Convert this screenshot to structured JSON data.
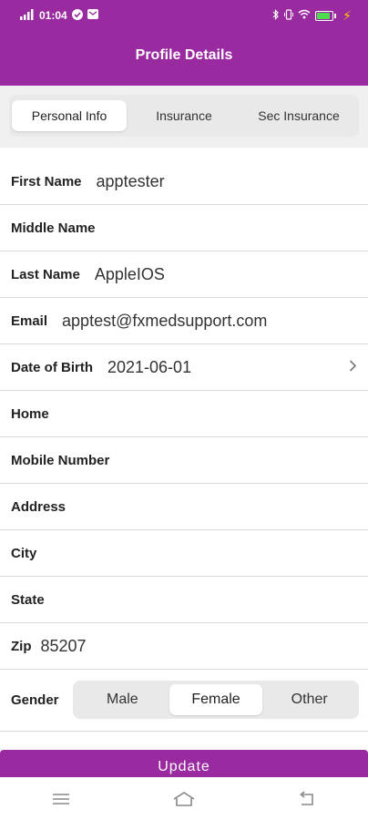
{
  "status_bar": {
    "time": "01:04",
    "signal_icon": "signal-icon",
    "check_icon": "check-circle-icon",
    "mail_icon": "mail-icon",
    "bluetooth_icon": "bluetooth-icon",
    "wifi_icon": "wifi-icon",
    "battery_level": "90",
    "battery_icon": "battery-icon",
    "charging_icon": "charging-bolt-icon"
  },
  "header": {
    "title": "Profile Details",
    "color": "#9a2aa0"
  },
  "tabs": [
    {
      "label": "Personal Info",
      "active": true
    },
    {
      "label": "Insurance",
      "active": false
    },
    {
      "label": "Sec Insurance",
      "active": false
    }
  ],
  "fields": {
    "first_name": {
      "label": "First Name",
      "value": "apptester"
    },
    "middle_name": {
      "label": "Middle Name",
      "value": ""
    },
    "last_name": {
      "label": "Last Name",
      "value": "AppleIOS"
    },
    "email": {
      "label": "Email",
      "value": "apptest@fxmedsupport.com"
    },
    "dob": {
      "label": "Date of Birth",
      "value": "2021-06-01"
    },
    "home": {
      "label": "Home",
      "value": ""
    },
    "mobile": {
      "label": "Mobile Number",
      "value": ""
    },
    "address": {
      "label": "Address",
      "value": ""
    },
    "city": {
      "label": "City",
      "value": ""
    },
    "state": {
      "label": "State",
      "value": ""
    },
    "zip": {
      "label": "Zip",
      "value": "85207"
    }
  },
  "gender": {
    "label": "Gender",
    "options": [
      "Male",
      "Female",
      "Other"
    ],
    "selected": "Female"
  },
  "update_button": {
    "label": "Update"
  },
  "nav": {
    "menu_icon": "menu-icon",
    "home_icon": "home-icon",
    "back_icon": "back-icon"
  }
}
